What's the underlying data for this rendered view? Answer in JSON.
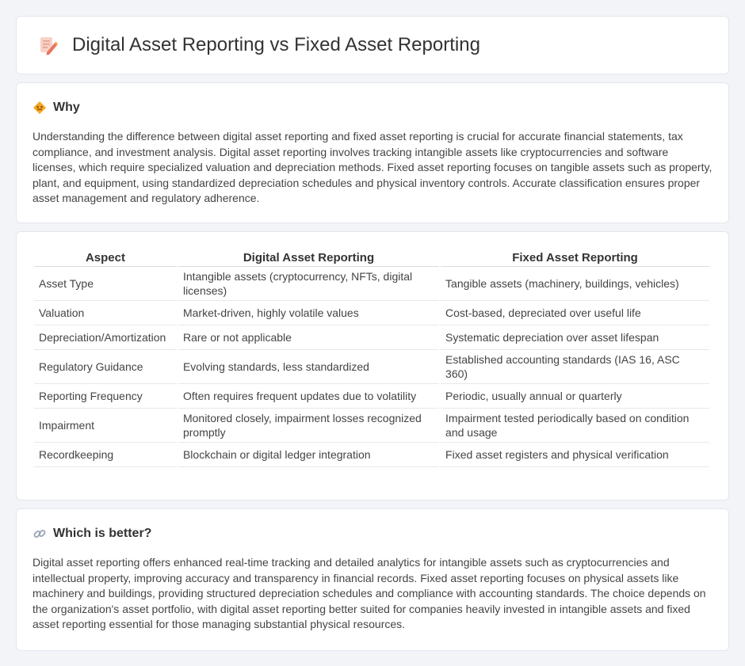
{
  "header": {
    "title": "Digital Asset Reporting vs Fixed Asset Reporting"
  },
  "why": {
    "heading": "Why",
    "text": "Understanding the difference between digital asset reporting and fixed asset reporting is crucial for accurate financial statements, tax compliance, and investment analysis. Digital asset reporting involves tracking intangible assets like cryptocurrencies and software licenses, which require specialized valuation and depreciation methods. Fixed asset reporting focuses on tangible assets such as property, plant, and equipment, using standardized depreciation schedules and physical inventory controls. Accurate classification ensures proper asset management and regulatory adherence."
  },
  "table": {
    "headers": [
      "Aspect",
      "Digital Asset Reporting",
      "Fixed Asset Reporting"
    ],
    "rows": [
      [
        "Asset Type",
        "Intangible assets (cryptocurrency, NFTs, digital licenses)",
        "Tangible assets (machinery, buildings, vehicles)"
      ],
      [
        "Valuation",
        "Market-driven, highly volatile values",
        "Cost-based, depreciated over useful life"
      ],
      [
        "Depreciation/Amortization",
        "Rare or not applicable",
        "Systematic depreciation over asset lifespan"
      ],
      [
        "Regulatory Guidance",
        "Evolving standards, less standardized",
        "Established accounting standards (IAS 16, ASC 360)"
      ],
      [
        "Reporting Frequency",
        "Often requires frequent updates due to volatility",
        "Periodic, usually annual or quarterly"
      ],
      [
        "Impairment",
        "Monitored closely, impairment losses recognized promptly",
        "Impairment tested periodically based on condition and usage"
      ],
      [
        "Recordkeeping",
        "Blockchain or digital ledger integration",
        "Fixed asset registers and physical verification"
      ]
    ]
  },
  "better": {
    "heading": "Which is better?",
    "text": "Digital asset reporting offers enhanced real-time tracking and detailed analytics for intangible assets such as cryptocurrencies and intellectual property, improving accuracy and transparency in financial records. Fixed asset reporting focuses on physical assets like machinery and buildings, providing structured depreciation schedules and compliance with accounting standards. The choice depends on the organization's asset portfolio, with digital asset reporting better suited for companies heavily invested in intangible assets and fixed asset reporting essential for those managing substantial physical resources."
  },
  "icons": {
    "title": "document-pencil-icon",
    "why": "diamond-warning-icon",
    "better": "link-icon"
  },
  "colors": {
    "background": "#f3f4f8",
    "card": "#ffffff",
    "accent_orange": "#f5a623",
    "accent_pink": "#e86a6a"
  }
}
